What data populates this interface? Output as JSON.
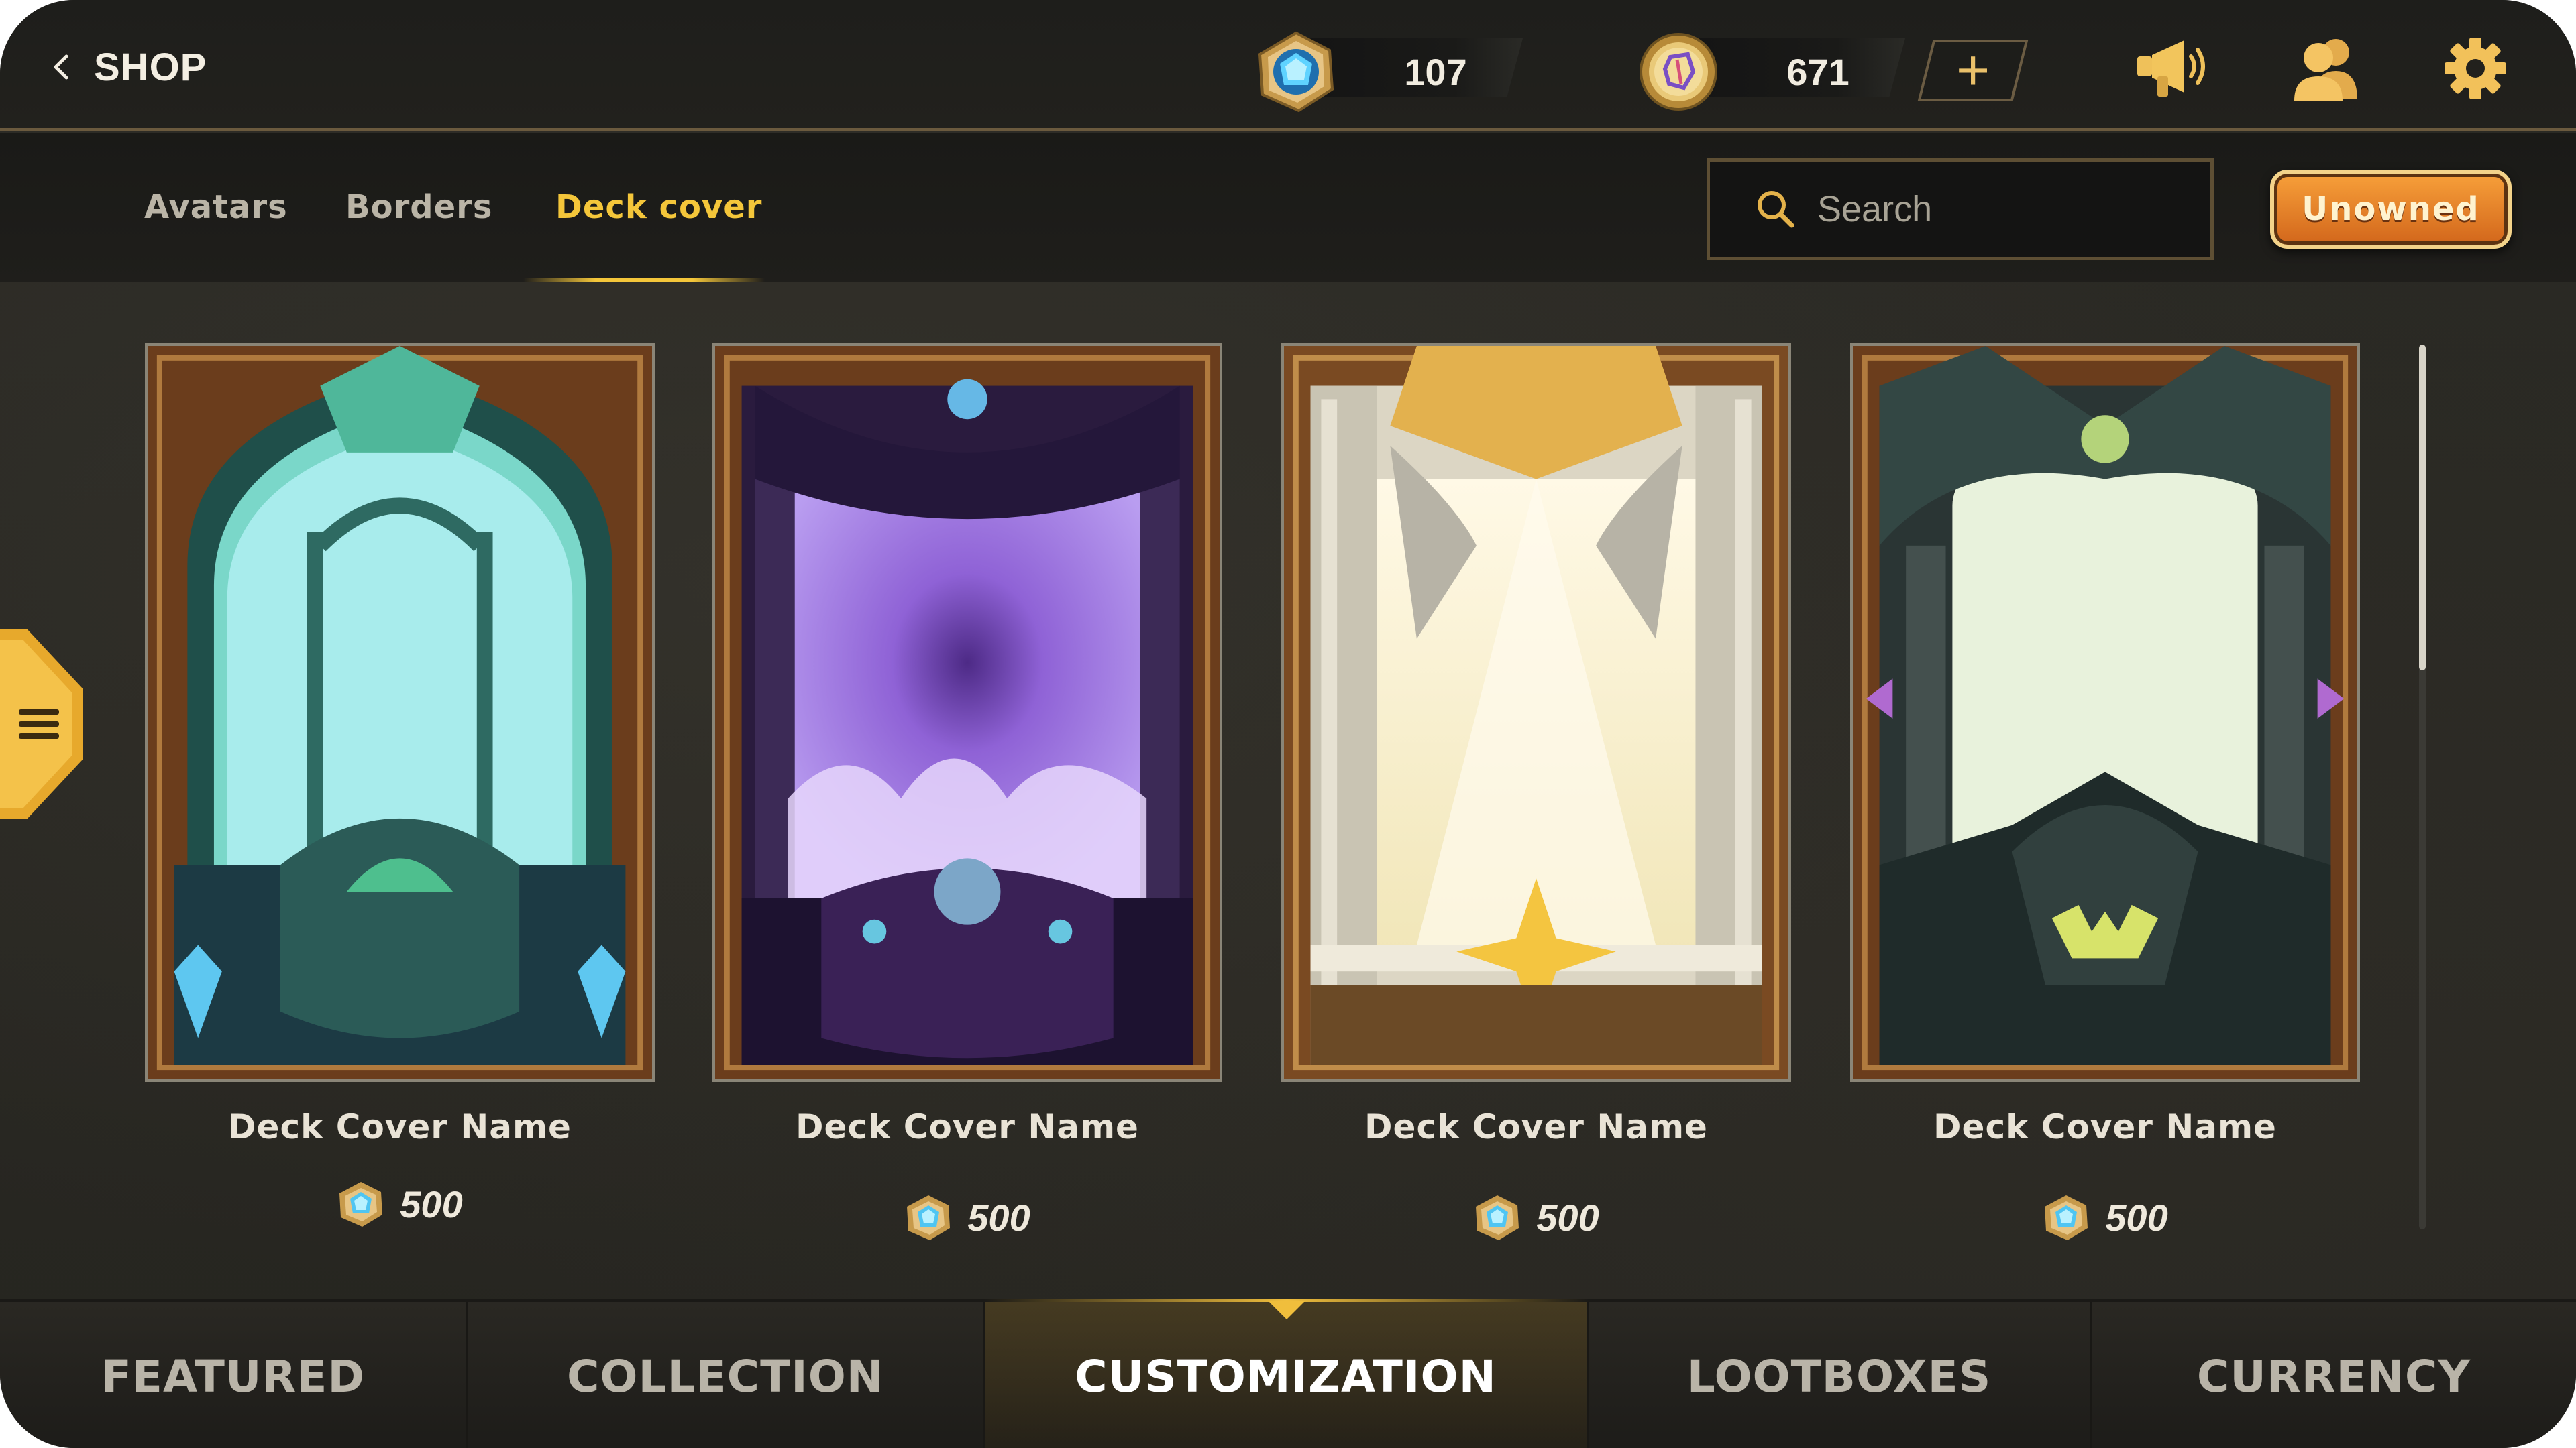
{
  "header": {
    "back_label": "SHOP",
    "gems": "107",
    "coins": "671",
    "add_label": "+"
  },
  "icons": {
    "back": "chevron-left-icon",
    "gem": "gem-currency-icon",
    "coin": "coin-currency-icon",
    "news": "megaphone-icon",
    "friends": "friends-icon",
    "settings": "gear-icon",
    "search": "search-icon",
    "side_menu": "hamburger-menu-icon"
  },
  "subtabs": {
    "items": [
      "Avatars",
      "Borders",
      "Deck cover"
    ],
    "active": "Deck cover"
  },
  "search": {
    "placeholder": "Search"
  },
  "filter": {
    "label": "Unowned"
  },
  "cards": [
    {
      "name": "Deck Cover Name",
      "price": "500",
      "theme": "emerald-gothic"
    },
    {
      "name": "Deck Cover Name",
      "price": "500",
      "theme": "violet-void"
    },
    {
      "name": "Deck Cover Name",
      "price": "500",
      "theme": "golden-celestial"
    },
    {
      "name": "Deck Cover Name",
      "price": "500",
      "theme": "dark-dragon"
    }
  ],
  "bottom_nav": {
    "items": [
      "FEATURED",
      "COLLECTION",
      "CUSTOMIZATION",
      "LOOTBOXES",
      "CURRENCY"
    ],
    "active": "CUSTOMIZATION"
  },
  "colors": {
    "accent_gold": "#f4c63a",
    "unowned_orange": "#e07f26",
    "background": "#262520",
    "text_primary": "#e9e3d6"
  }
}
